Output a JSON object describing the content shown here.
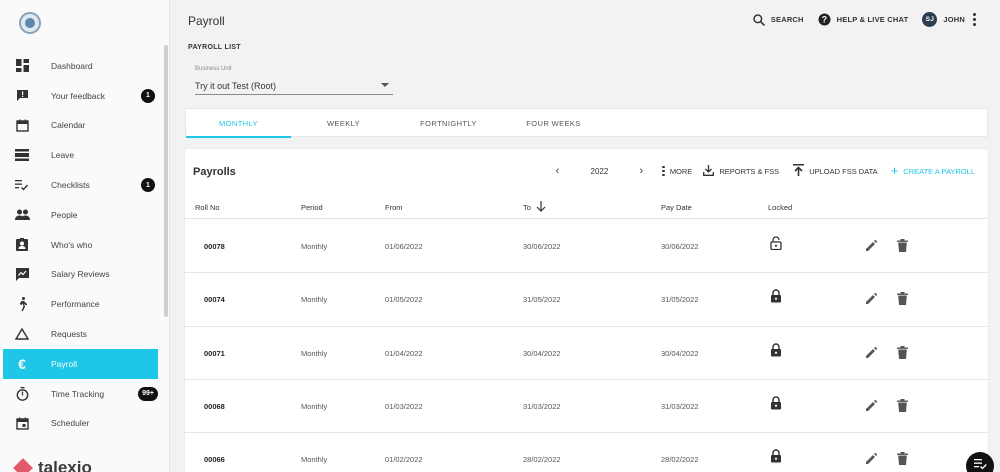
{
  "header": {
    "title": "Payroll",
    "search_label": "SEARCH",
    "help_label": "HELP & LIVE CHAT",
    "user_initials": "SJ",
    "user_name": "JOHN"
  },
  "sidebar": {
    "items": [
      {
        "label": "Dashboard",
        "icon": "dashboard-icon"
      },
      {
        "label": "Your feedback",
        "icon": "feedback-icon",
        "badge": "1"
      },
      {
        "label": "Calendar",
        "icon": "calendar-icon"
      },
      {
        "label": "Leave",
        "icon": "leave-icon"
      },
      {
        "label": "Checklists",
        "icon": "checklist-icon",
        "badge": "1"
      },
      {
        "label": "People",
        "icon": "people-icon"
      },
      {
        "label": "Who's who",
        "icon": "whos-who-icon"
      },
      {
        "label": "Salary Reviews",
        "icon": "salary-review-icon"
      },
      {
        "label": "Performance",
        "icon": "performance-icon"
      },
      {
        "label": "Requests",
        "icon": "requests-icon"
      },
      {
        "label": "Payroll",
        "icon": "euro-icon",
        "active": true
      },
      {
        "label": "Time Tracking",
        "icon": "timer-icon",
        "badge": "99+"
      },
      {
        "label": "Scheduler",
        "icon": "scheduler-icon"
      }
    ],
    "brand": "talexio",
    "active_color": "#1ec6e8"
  },
  "main": {
    "section_title": "PAYROLL LIST",
    "business_unit_label": "Business Unit",
    "business_unit_value": "Try it out Test (Root)",
    "tabs": [
      {
        "label": "MONTHLY",
        "active": true
      },
      {
        "label": "WEEKLY"
      },
      {
        "label": "FORTNIGHTLY"
      },
      {
        "label": "FOUR WEEKS"
      }
    ],
    "card": {
      "title": "Payrolls",
      "year": "2022",
      "more_label": "MORE",
      "reports_label": "REPORTS & FSS",
      "upload_label": "UPLOAD FSS DATA",
      "create_label": "CREATE A PAYROLL"
    },
    "table": {
      "columns": [
        "Roll No",
        "Period",
        "From",
        "To",
        "Pay Date",
        "Locked"
      ],
      "rows": [
        {
          "roll": "00078",
          "period": "Monthly",
          "from": "01/06/2022",
          "to": "30/06/2022",
          "pay": "30/06/2022",
          "locked": false
        },
        {
          "roll": "00074",
          "period": "Monthly",
          "from": "01/05/2022",
          "to": "31/05/2022",
          "pay": "31/05/2022",
          "locked": true
        },
        {
          "roll": "00071",
          "period": "Monthly",
          "from": "01/04/2022",
          "to": "30/04/2022",
          "pay": "30/04/2022",
          "locked": true
        },
        {
          "roll": "00068",
          "period": "Monthly",
          "from": "01/03/2022",
          "to": "31/03/2022",
          "pay": "31/03/2022",
          "locked": true
        },
        {
          "roll": "00066",
          "period": "Monthly",
          "from": "01/02/2022",
          "to": "28/02/2022",
          "pay": "28/02/2022",
          "locked": true
        }
      ]
    }
  }
}
